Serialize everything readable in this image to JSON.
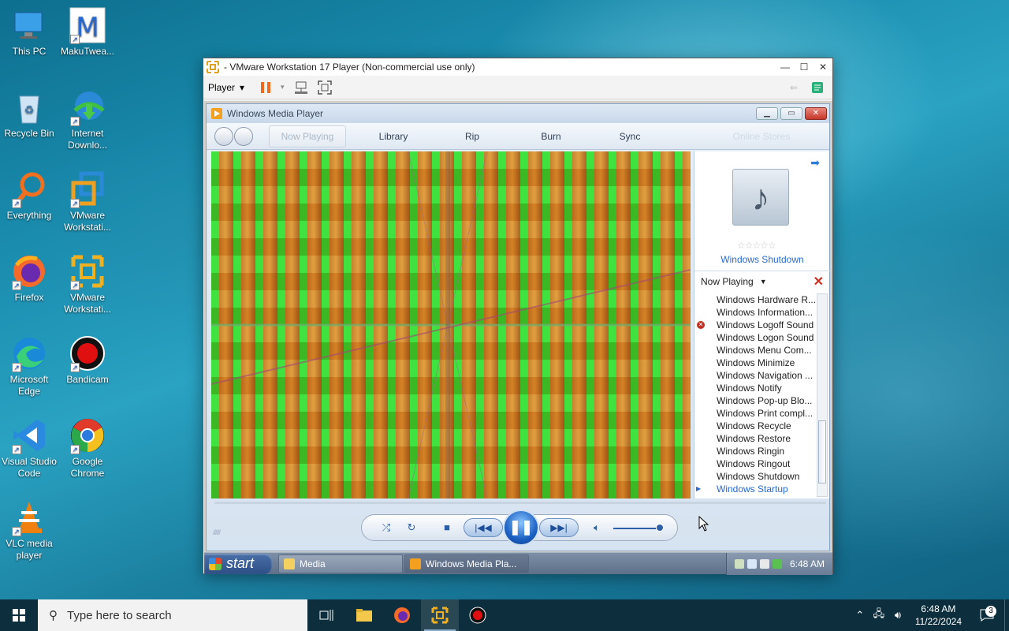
{
  "desktop": {
    "icons": [
      {
        "label": "This PC"
      },
      {
        "label": "MakuTwea..."
      },
      {
        "label": "Recycle Bin"
      },
      {
        "label": "Internet Downlo..."
      },
      {
        "label": "Everything"
      },
      {
        "label": "VMware Workstati..."
      },
      {
        "label": "Firefox"
      },
      {
        "label": "VMware Workstati..."
      },
      {
        "label": "Microsoft Edge"
      },
      {
        "label": "Bandicam"
      },
      {
        "label": "Visual Studio Code"
      },
      {
        "label": "Google Chrome"
      },
      {
        "label": "VLC media player"
      }
    ]
  },
  "vmware": {
    "title": "- VMware Workstation 17 Player (Non-commercial use only)",
    "player_menu": "Player",
    "win_buttons": {
      "minimize": "—",
      "maximize": "☐",
      "close": "✕"
    }
  },
  "wmp": {
    "title": "Windows Media Player",
    "tabs": {
      "now_playing": "Now Playing",
      "library": "Library",
      "rip": "Rip",
      "burn": "Burn",
      "sync": "Sync",
      "online_stores": "Online Stores"
    },
    "now_playing_title": "Windows Shutdown",
    "rating_stars": "☆☆☆☆☆",
    "list_header": "Now Playing",
    "playlist": [
      "Windows Hardware R...",
      "Windows Information...",
      "Windows Logoff Sound",
      "Windows Logon Sound",
      "Windows Menu Com...",
      "Windows Minimize",
      "Windows Navigation ...",
      "Windows Notify",
      "Windows Pop-up Blo...",
      "Windows Print compl...",
      "Windows Recycle",
      "Windows Restore",
      "Windows Ringin",
      "Windows Ringout",
      "Windows Shutdown",
      "Windows Startup"
    ],
    "error_item_index": 2,
    "current_item_index": 15,
    "volume_level": 0.95
  },
  "guest_taskbar": {
    "start_label": "start",
    "tasks": [
      {
        "label": "Media"
      },
      {
        "label": "Windows Media Pla..."
      }
    ],
    "clock": "6:48 AM"
  },
  "host_taskbar": {
    "search_placeholder": "Type here to search",
    "time": "6:48 AM",
    "date": "11/22/2024",
    "notification_count": "3"
  },
  "colors": {
    "viz_green": "#3fe23f",
    "viz_orange": "#c5822e",
    "wmp_accent": "#2a6ad0",
    "taskbar_bg": "#0d2f3d"
  }
}
